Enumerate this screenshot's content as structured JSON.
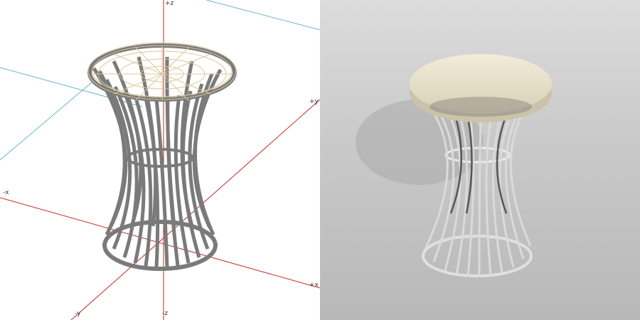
{
  "viewport_left": {
    "axis_labels": {
      "pz": "+z",
      "nz": "-z",
      "py": "+y",
      "ny": "-y",
      "px": "+x",
      "nx": "-x"
    },
    "colors": {
      "axis": "#c62828",
      "axis2": "#69b7c9",
      "wire": "#7a7a7a",
      "cushion_wire": "#d9c89a"
    }
  },
  "viewport_right": {
    "colors": {
      "background_top": "#dcdcdc",
      "background_bottom": "#b8b8b8",
      "cushion": "#e8e0c8",
      "frame": "#d0d0d0"
    }
  }
}
